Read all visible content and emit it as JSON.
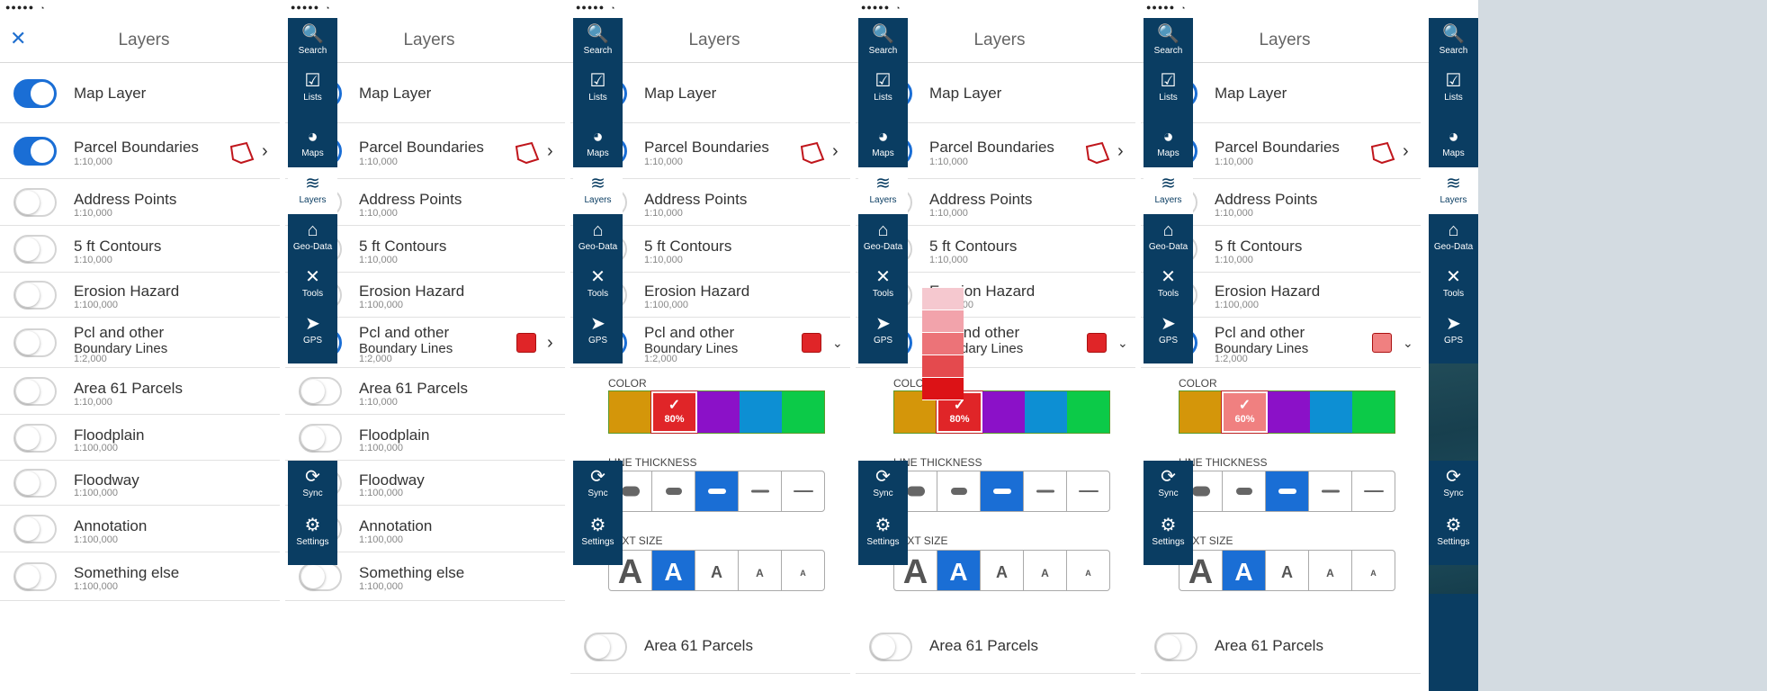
{
  "status": {
    "signal": "●●●●●",
    "wifi": "◔"
  },
  "header": {
    "title": "Layers",
    "close_icon": "close-icon"
  },
  "rail": [
    {
      "label": "Search",
      "icon": "🔍"
    },
    {
      "label": "Lists",
      "icon": "☑"
    },
    {
      "label": "Maps",
      "icon": "◕"
    },
    {
      "label": "Layers",
      "icon": "≋"
    },
    {
      "label": "Geo-Data",
      "icon": "⌂"
    },
    {
      "label": "Tools",
      "icon": "✕"
    },
    {
      "label": "GPS",
      "icon": "➤"
    },
    {
      "label": "Sync",
      "icon": "⟳"
    },
    {
      "label": "Settings",
      "icon": "⚙"
    }
  ],
  "map_layer": "Map Layer",
  "layers": [
    {
      "name": "Parcel Boundaries",
      "scale": "1:10,000"
    },
    {
      "name": "Address Points",
      "scale": "1:10,000"
    },
    {
      "name": "5 ft Contours",
      "scale": "1:10,000"
    },
    {
      "name": "Erosion Hazard",
      "scale": "1:100,000"
    },
    {
      "name": "Pcl and other",
      "name2": "Boundary Lines",
      "scale": "1:2,000"
    },
    {
      "name": "Area 61 Parcels",
      "scale": "1:10,000"
    },
    {
      "name": "Floodplain",
      "scale": "1:100,000"
    },
    {
      "name": "Floodway",
      "scale": "1:100,000"
    },
    {
      "name": "Annotation",
      "scale": "1:100,000"
    },
    {
      "name": "Something else",
      "scale": "1:100,000"
    }
  ],
  "style_panel": {
    "color_label": "COLOR",
    "thickness_label": "LINE THICKNESS",
    "text_size_label": "TEXT SIZE",
    "colors": [
      "#d4960a",
      "#e02528",
      "#8b11c8",
      "#0d8fd3",
      "#0cca48"
    ],
    "check": "✓",
    "text_sizes": [
      "A",
      "A",
      "A",
      "A",
      "A"
    ]
  },
  "screens": [
    {
      "id": 1,
      "expanded": false,
      "pcl_on": false,
      "pcl_color": null,
      "opacity": null
    },
    {
      "id": 2,
      "expanded": false,
      "pcl_on": true,
      "pcl_color": "#e02528",
      "opacity": null
    },
    {
      "id": 3,
      "expanded": true,
      "pcl_on": true,
      "pcl_color": "#e02528",
      "opacity": "80%"
    },
    {
      "id": 4,
      "expanded": true,
      "pcl_on": true,
      "pcl_color": "#e02528",
      "opacity": "80%",
      "opacity_picker_open": true
    },
    {
      "id": 5,
      "expanded": true,
      "pcl_on": true,
      "pcl_color": "#f08080",
      "opacity": "60%"
    }
  ],
  "opacity_swatches": [
    "#f5c8cf",
    "#f2a3ab",
    "#ec7378",
    "#e44a4e",
    "#dc1216"
  ]
}
